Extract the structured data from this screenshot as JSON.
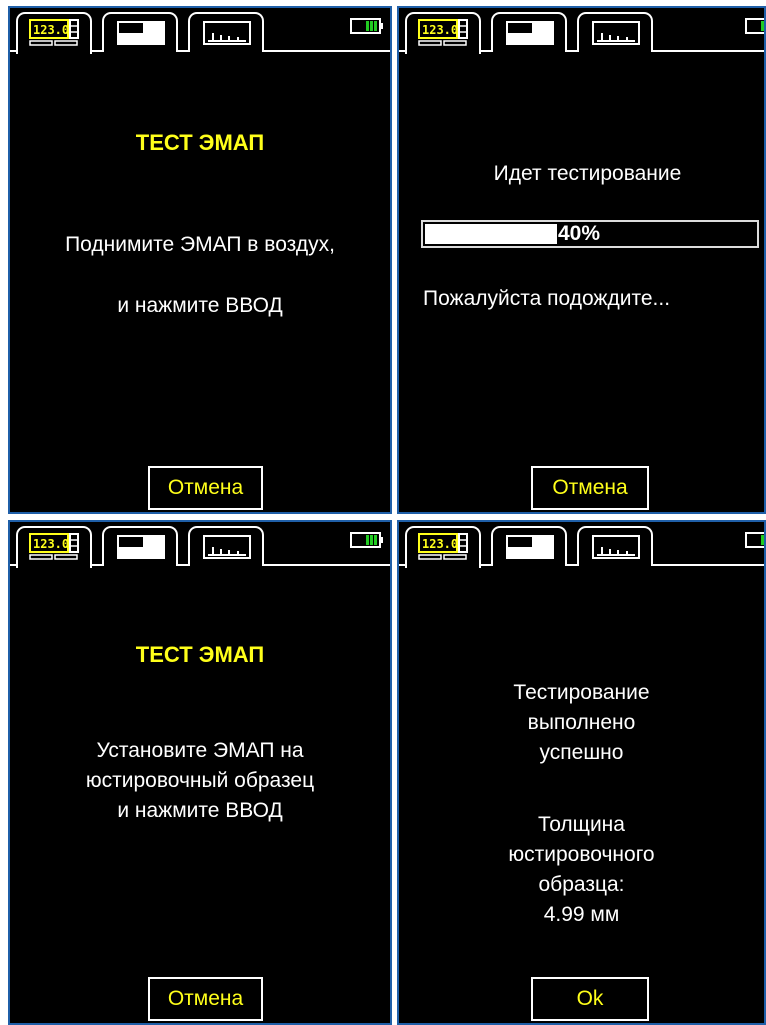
{
  "tabs": {
    "numeric_icon": "numeric-display-icon",
    "bar_icon": "bar-display-icon",
    "graph_icon": "graph-display-icon",
    "battery_icon": "battery-full-icon"
  },
  "colors": {
    "background": "#000000",
    "text": "#ffffff",
    "accent": "#ffff1a",
    "battery": "#22cc22",
    "frame": "#1f5fa8"
  },
  "screen1": {
    "title": "ТЕСТ ЭМАП",
    "line1": "Поднимите ЭМАП в воздух,",
    "line2": "и нажмите ВВОД",
    "button": "Отмена"
  },
  "screen2": {
    "line1": "Идет тестирование",
    "progress_value": 0.4,
    "progress_label": "40%",
    "line2": "Пожалуйста подождите...",
    "button": "Отмена"
  },
  "screen3": {
    "title": "ТЕСТ ЭМАП",
    "line1": "Установите ЭМАП на",
    "line2": "юстировочный образец",
    "line3": "и нажмите ВВОД",
    "button": "Отмена"
  },
  "screen4": {
    "line1": "Тестирование",
    "line2": "выполнено",
    "line3": "успешно",
    "line4": "Толщина",
    "line5": "юстировочного",
    "line6": "образца:",
    "line7": "4.99 мм",
    "button": "Ok"
  }
}
